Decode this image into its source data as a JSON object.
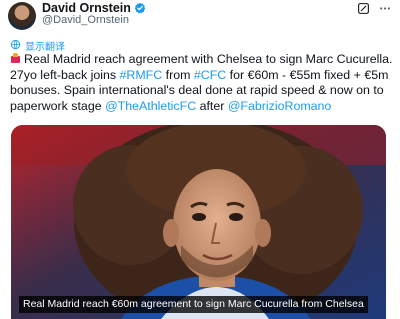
{
  "author": {
    "display_name": "David Ornstein",
    "handle": "@David_Ornstein",
    "verified_icon": "verified-badge-icon"
  },
  "icons": {
    "more": "more-icon",
    "grok": "grok-icon",
    "translate": "translate-icon",
    "emoji": "siren-emoji-icon"
  },
  "translate_label": "显示翻译",
  "tweet": {
    "line1_text": "Real Madrid reach agreement with Chelsea to sign Marc Cucurella.",
    "line2_a": "27yo left-back joins ",
    "line2_tag1": "#RMFC",
    "line2_b": " from ",
    "line2_tag2": "#CFC",
    "line2_c": " for €60m - €55m fixed + €5m",
    "line3_text": "bonuses. Spain international's deal done at rapid speed & now on to",
    "line4_a": "paperwork stage ",
    "line4_mention1": "@TheAthleticFC",
    "line4_b": " after ",
    "line4_mention2": "@FabrizioRomano"
  },
  "media": {
    "caption": "Real Madrid reach €60m agreement to sign Marc Cucurella from Chelsea"
  },
  "colors": {
    "link": "#1d9bf0",
    "text": "#0f1419",
    "secondary": "#536471",
    "verified": "#1d9bf0"
  }
}
